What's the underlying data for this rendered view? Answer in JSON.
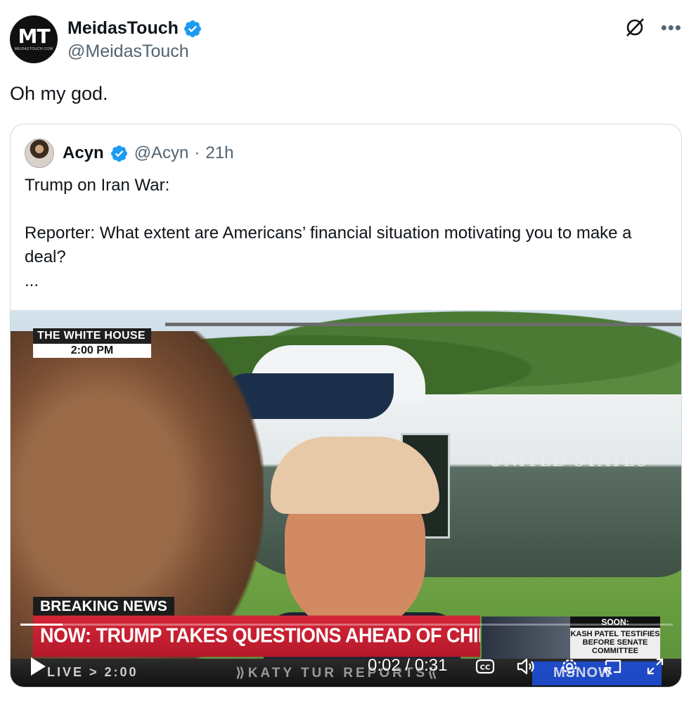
{
  "post": {
    "author_name": "MeidasTouch",
    "author_handle": "@MeidasTouch",
    "avatar_initials": "MT",
    "avatar_subtext": "MEIDASTOUCH.COM",
    "text": "Oh my god."
  },
  "quote": {
    "author_name": "Acyn",
    "author_handle": "@Acyn",
    "separator": "·",
    "time": "21h",
    "lines": [
      "Trump on Iran War:",
      "",
      "Reporter: What extent are Americans’ financial situation motivating you to make a deal?",
      "..."
    ]
  },
  "video": {
    "location_badge": "THE WHITE HOUSE",
    "location_time": "2:00 PM",
    "aircraft_marking": "UNITED  STATES",
    "breaking_label": "BREAKING NEWS",
    "chyron": "NOW: TRUMP TAKES QUESTIONS AHEAD OF CHINA DEPARTURE",
    "soon_label": "SOON:",
    "soon_text": "KASH PATEL TESTIFIES BEFORE SENATE COMMITTEE",
    "ticker_live": "LIVE > 2:00",
    "ticker_show": "⟫KATY TUR REPORTS⟪",
    "network_logo": "MSNOW",
    "current_time": "0:02",
    "duration": "0:31",
    "time_display": "0:02 / 0:31",
    "progress_fraction": 0.0645
  },
  "icons": {
    "verified": "verified-badge-icon",
    "grok": "grok-icon",
    "more": "more-icon",
    "play": "play-icon",
    "captions": "captions-icon",
    "volume": "volume-icon",
    "settings": "settings-icon",
    "pip": "picture-in-picture-icon",
    "fullscreen": "fullscreen-icon"
  },
  "colors": {
    "verified_blue": "#1d9bf0",
    "text_primary": "#0f1419",
    "text_secondary": "#536471",
    "chyron_red": "#c41e30"
  },
  "more_glyph": "•••"
}
